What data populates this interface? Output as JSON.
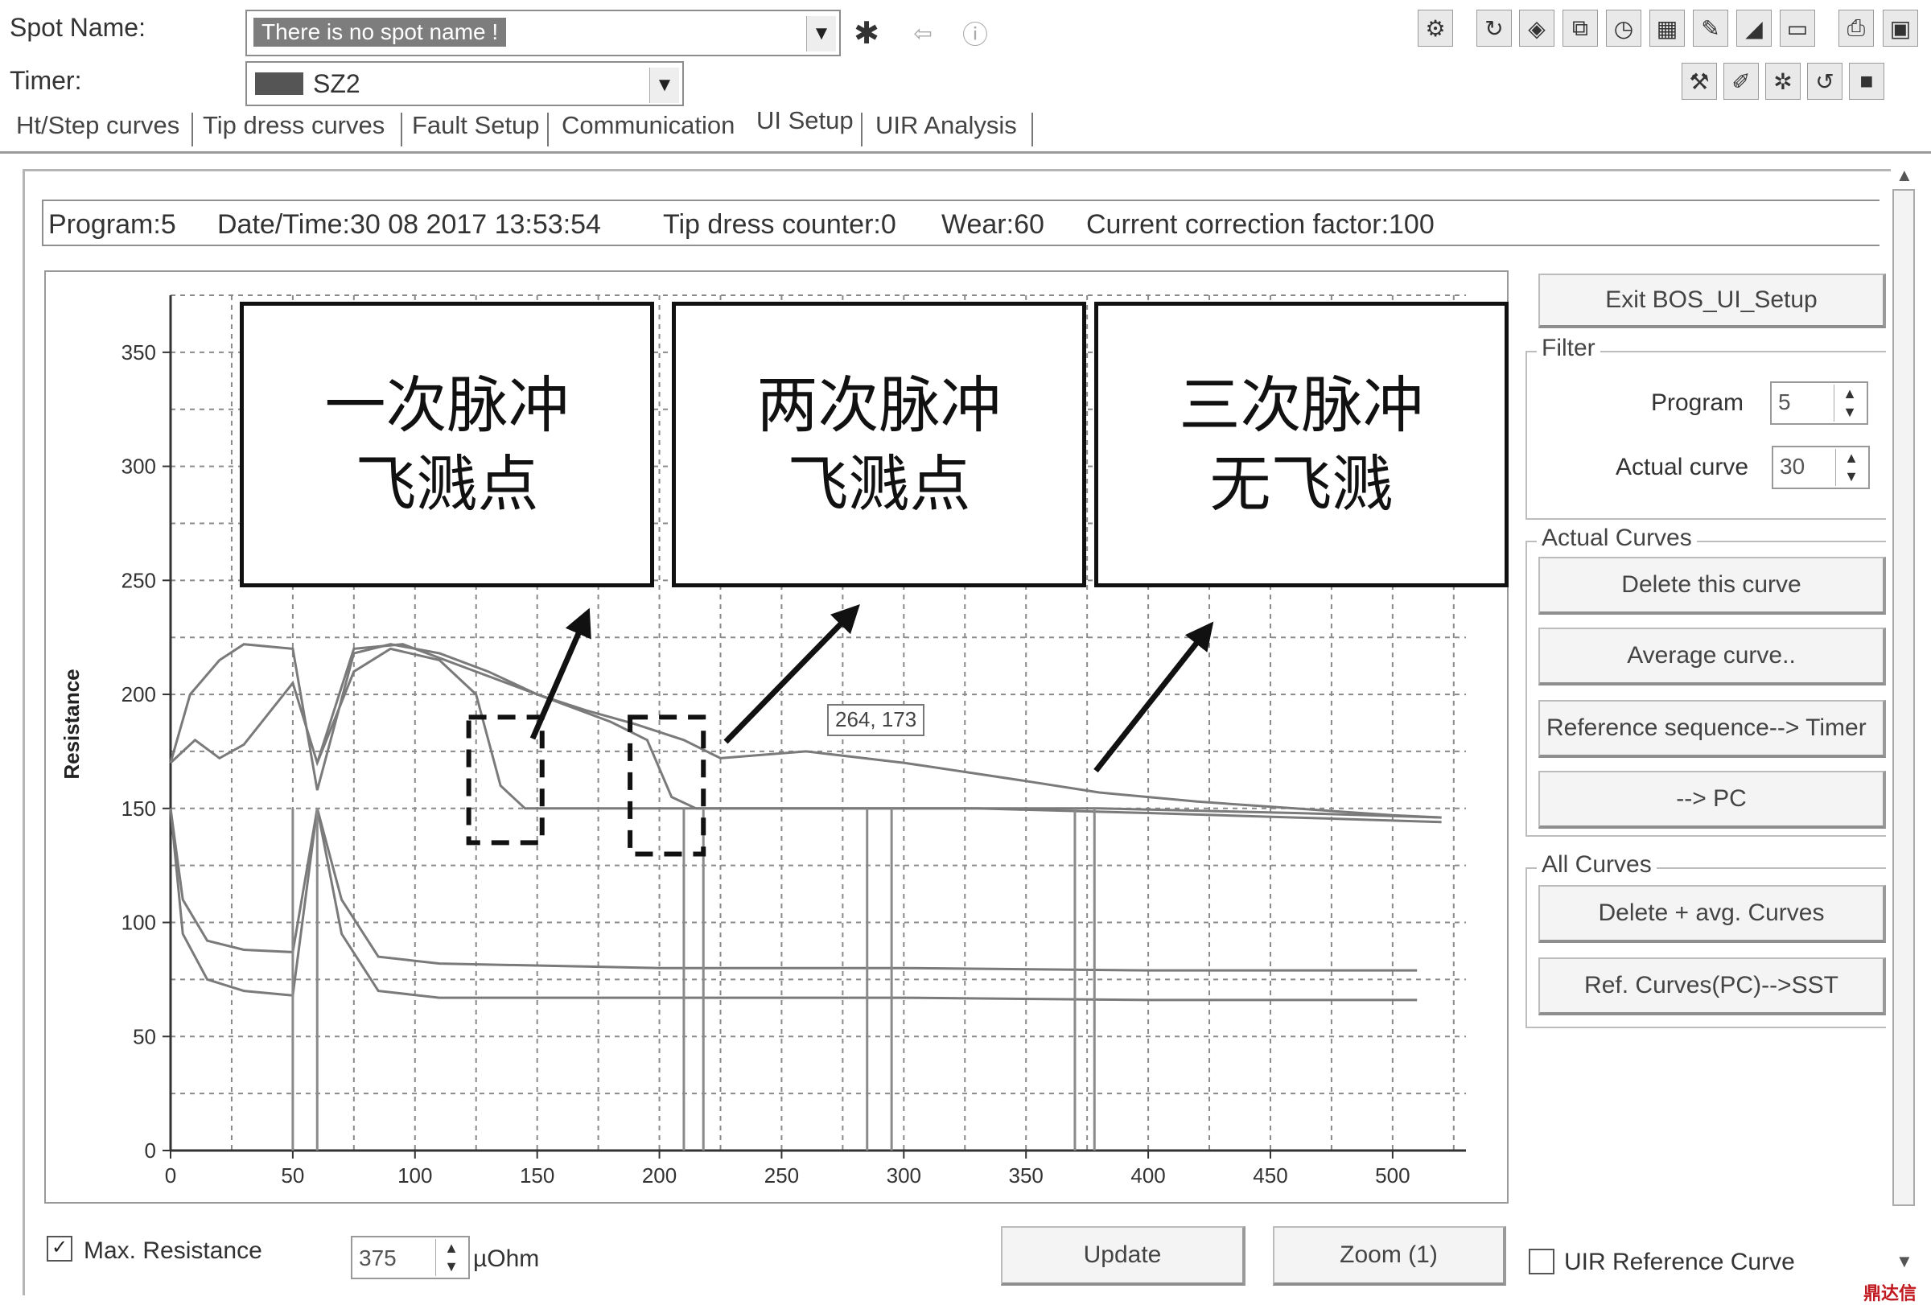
{
  "spot_name": {
    "label": "Spot Name:",
    "value": "There is no spot name !"
  },
  "timer": {
    "label": "Timer:",
    "value": "SZ2"
  },
  "tabs": [
    "Ht/Step curves",
    "Tip dress curves",
    "Fault Setup",
    "Communication",
    "UI Setup",
    "UIR Analysis"
  ],
  "active_tab": "UI Setup",
  "info_bar": {
    "program": "Program:5",
    "datetime": "Date/Time:30 08 2017 13:53:54",
    "tip_dress": "Tip dress counter:0",
    "wear": "Wear:60",
    "correction": "Current correction factor:100"
  },
  "buttons": {
    "exit": "Exit BOS_UI_Setup",
    "delete_curve": "Delete this curve",
    "average_curve": "Average curve..",
    "ref_sequence": "Reference sequence--> Timer",
    "to_pc": "--> PC",
    "delete_avg": "Delete + avg. Curves",
    "ref_curves": "Ref. Curves(PC)-->SST",
    "update": "Update",
    "zoom": "Zoom (1)"
  },
  "filter": {
    "title": "Filter",
    "program_label": "Program",
    "program_value": "5",
    "actual_label": "Actual curve",
    "actual_value": "30"
  },
  "groups": {
    "actual_curves": "Actual Curves",
    "all_curves": "All Curves"
  },
  "bottom": {
    "max_resistance_label": "Max. Resistance",
    "max_resistance_value": "375",
    "unit": "µOhm",
    "uir_label": "UIR Reference Curve"
  },
  "tooltip": "264, 173",
  "annotations": [
    {
      "line1": "一次脉冲",
      "line2": "飞溅点"
    },
    {
      "line1": "两次脉冲",
      "line2": "飞溅点"
    },
    {
      "line1": "三次脉冲",
      "line2": "无飞溅"
    }
  ],
  "watermark": "鼎达信",
  "chart_data": {
    "type": "line",
    "title": "",
    "xlabel": "",
    "ylabel": "Resistance",
    "xlim": [
      0,
      530
    ],
    "ylim": [
      0,
      375
    ],
    "xticks": [
      "0",
      "50",
      "100",
      "150",
      "200",
      "250",
      "300",
      "350",
      "400",
      "450",
      "500"
    ],
    "yticks": [
      "0",
      "50",
      "100",
      "150",
      "200",
      "250",
      "300",
      "350"
    ],
    "grid": true,
    "series": [
      {
        "x": [
          0,
          8,
          20,
          30,
          50,
          60,
          75,
          90,
          110,
          130,
          150,
          170,
          190,
          210,
          225,
          260,
          300,
          350,
          380,
          420,
          460,
          500,
          520
        ],
        "y": [
          170,
          200,
          215,
          222,
          220,
          158,
          218,
          222,
          218,
          210,
          200,
          193,
          187,
          180,
          172,
          175,
          170,
          162,
          157,
          153,
          150,
          147,
          146
        ]
      },
      {
        "x": [
          0,
          10,
          20,
          30,
          50,
          60,
          75,
          90,
          110,
          125,
          135,
          145,
          170,
          200,
          250,
          300,
          380,
          460,
          520
        ],
        "y": [
          170,
          180,
          172,
          178,
          205,
          170,
          210,
          220,
          215,
          200,
          160,
          150,
          150,
          150,
          150,
          150,
          150,
          148,
          146
        ]
      },
      {
        "x": [
          60,
          75,
          95,
          120,
          150,
          180,
          195,
          205,
          215,
          260,
          330,
          400,
          460,
          520
        ],
        "y": [
          170,
          220,
          222,
          212,
          200,
          188,
          180,
          155,
          150,
          150,
          150,
          148,
          146,
          144
        ]
      },
      {
        "x": [
          0,
          5,
          15,
          30,
          50,
          60,
          70,
          85,
          110,
          200,
          300,
          400,
          510
        ],
        "y": [
          150,
          110,
          92,
          88,
          87,
          150,
          110,
          85,
          82,
          80,
          80,
          79,
          79
        ]
      },
      {
        "x": [
          0,
          5,
          15,
          30,
          50,
          60,
          70,
          85,
          110,
          200,
          300,
          400,
          510
        ],
        "y": [
          150,
          95,
          75,
          70,
          68,
          150,
          95,
          70,
          67,
          67,
          67,
          66,
          66
        ]
      }
    ],
    "drops": [
      50,
      60,
      210,
      218,
      285,
      295,
      370,
      378
    ]
  }
}
